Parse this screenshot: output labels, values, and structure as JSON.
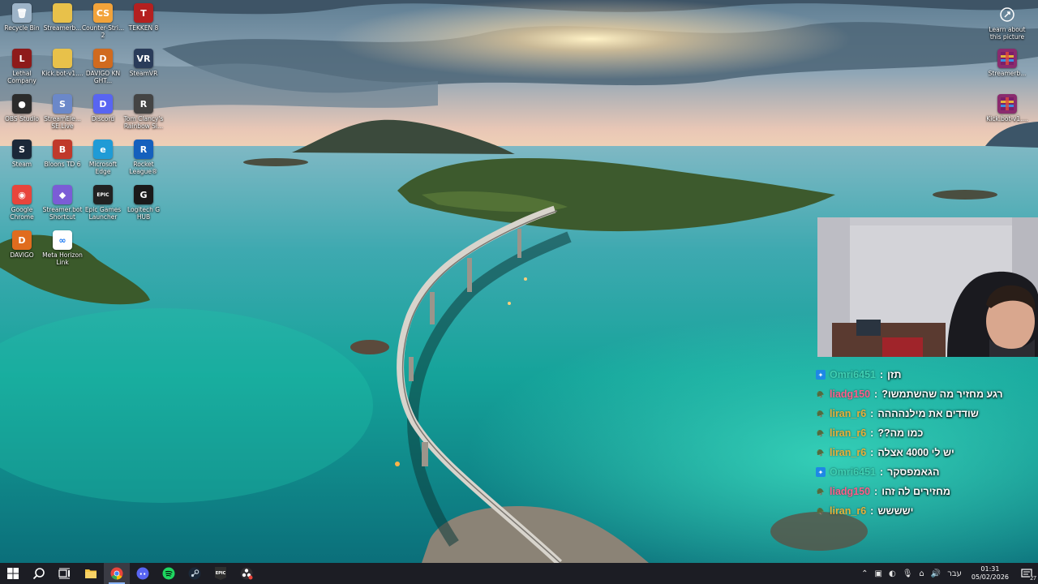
{
  "desktop_icons": [
    {
      "label": "Recycle Bin",
      "icon": "recycle-bin-icon",
      "color": "#9db4c8",
      "glyph": "🗑"
    },
    {
      "label": "Streamerb...",
      "icon": "folder-icon",
      "color": "#e8c14a",
      "glyph": ""
    },
    {
      "label": "Counter-Stri... 2",
      "icon": "counter-strike-icon",
      "color": "#f2a33a",
      "glyph": "CS"
    },
    {
      "label": "TEKKEN 8",
      "icon": "tekken-icon",
      "color": "#b52020",
      "glyph": "T"
    },
    {
      "label": "Lethal Company",
      "icon": "lethal-company-icon",
      "color": "#8e1a1a",
      "glyph": "L"
    },
    {
      "label": "Kick.bot-v1....",
      "icon": "folder-icon",
      "color": "#e8c14a",
      "glyph": ""
    },
    {
      "label": "DAVIGO KN GHT...",
      "icon": "davigo-icon",
      "color": "#d06a1e",
      "glyph": "D"
    },
    {
      "label": "SteamVR",
      "icon": "steamvr-icon",
      "color": "#2a3c5a",
      "glyph": "VR"
    },
    {
      "label": "OBS Studio",
      "icon": "obs-icon",
      "color": "#2b2b2b",
      "glyph": "●"
    },
    {
      "label": "StreamEle... SE.Live",
      "icon": "streamelements-icon",
      "color": "#6b88c9",
      "glyph": "S"
    },
    {
      "label": "Discord",
      "icon": "discord-icon",
      "color": "#5865f2",
      "glyph": "D"
    },
    {
      "label": "Tom Clancy's Rainbow Si...",
      "icon": "rainbow-six-icon",
      "color": "#444444",
      "glyph": "R"
    },
    {
      "label": "Steam",
      "icon": "steam-icon",
      "color": "#1b2838",
      "glyph": "S"
    },
    {
      "label": "Bloons TD 6",
      "icon": "bloons-icon",
      "color": "#c0392b",
      "glyph": "B"
    },
    {
      "label": "Microsoft Edge",
      "icon": "edge-icon",
      "color": "#1f9bd6",
      "glyph": "e"
    },
    {
      "label": "Rocket League®",
      "icon": "rocket-league-icon",
      "color": "#1560bd",
      "glyph": "R"
    },
    {
      "label": "Google Chrome",
      "icon": "chrome-icon",
      "color": "#e8453c",
      "glyph": "◉"
    },
    {
      "label": "Streamer.bot Shortcut",
      "icon": "streamerbot-icon",
      "color": "#7b5cd6",
      "glyph": "◆"
    },
    {
      "label": "Epic Games Launcher",
      "icon": "epic-games-icon",
      "color": "#222222",
      "glyph": "EPIC"
    },
    {
      "label": "Logitech G HUB",
      "icon": "logitech-icon",
      "color": "#1a1a1a",
      "glyph": "G"
    },
    {
      "label": "DAVIGO",
      "icon": "davigo-icon",
      "color": "#e06c1e",
      "glyph": "D"
    },
    {
      "label": "Meta Horizon Link",
      "icon": "meta-icon",
      "color": "#ffffff",
      "glyph": "∞"
    }
  ],
  "top_right_icons": [
    {
      "label": "Learn about this picture",
      "icon": "camera-info-icon"
    },
    {
      "label": "Streamerb...",
      "icon": "winrar-icon"
    },
    {
      "label": "Kick.bot-v1....",
      "icon": "winrar-icon"
    }
  ],
  "chat": {
    "separator": ":",
    "messages": [
      {
        "user": "Omri6451",
        "user_color": "#3fd0b3",
        "badge": "twitch",
        "text": "תזן"
      },
      {
        "user": "liadg150",
        "user_color": "#ff5f8a",
        "badge": "kick",
        "text": "רגע מחזיר מה שהשתמשו?"
      },
      {
        "user": "liran_r6",
        "user_color": "#e8b13a",
        "badge": "kick",
        "text": "שודדים את מילנהההה"
      },
      {
        "user": "liran_r6",
        "user_color": "#e8b13a",
        "badge": "kick",
        "text": "כמו מה??"
      },
      {
        "user": "liran_r6",
        "user_color": "#e8b13a",
        "badge": "kick",
        "text": "יש לי 4000 אצלה"
      },
      {
        "user": "Omri6451",
        "user_color": "#3fd0b3",
        "badge": "twitch",
        "text": "הגאמפסקר"
      },
      {
        "user": "liadg150",
        "user_color": "#ff5f8a",
        "badge": "kick",
        "text": "מחזירים לה זהו"
      },
      {
        "user": "liran_r6",
        "user_color": "#e8b13a",
        "badge": "kick",
        "text": "ישששש"
      }
    ]
  },
  "taskbar": {
    "apps": [
      {
        "icon": "windows-start-icon",
        "active": false
      },
      {
        "icon": "search-icon",
        "active": false
      },
      {
        "icon": "task-view-icon",
        "active": false
      },
      {
        "icon": "file-explorer-icon",
        "active": false
      },
      {
        "icon": "chrome-icon",
        "active": true
      },
      {
        "icon": "discord-icon",
        "active": false
      },
      {
        "icon": "spotify-icon",
        "active": false
      },
      {
        "icon": "steam-icon",
        "active": false
      },
      {
        "icon": "epic-games-icon",
        "active": false
      },
      {
        "icon": "obs-icon",
        "active": false
      }
    ],
    "language": "עבר",
    "time": "01:31",
    "date": "05/02/2026",
    "notification_count": "27"
  }
}
